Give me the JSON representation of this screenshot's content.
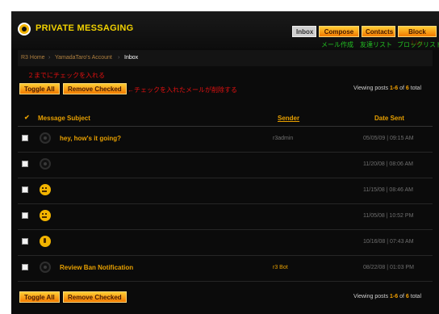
{
  "header": {
    "title": "PRIVATE MESSAGING",
    "tabs": [
      {
        "label": "Inbox",
        "note": ""
      },
      {
        "label": "Compose",
        "note": "メール作成"
      },
      {
        "label": "Contacts",
        "note": "友達リスト"
      },
      {
        "label": "Block List",
        "note": "ブロックリスト"
      }
    ]
  },
  "breadcrumb": {
    "items": [
      "R3 Home",
      "YamadaTaro's Account",
      "Inbox"
    ]
  },
  "annotations": {
    "check_note": "２までにチェックを入れる",
    "delete_note": "←チェックを入れたメールが削除する"
  },
  "actions": {
    "toggle_all": "Toggle All",
    "remove_checked": "Remove Checked",
    "viewing_prefix": "Viewing posts",
    "viewing_range": "1-6",
    "viewing_of": "of",
    "viewing_total": "6",
    "viewing_suffix": "total"
  },
  "table": {
    "headers": {
      "check": "✔",
      "subject": "Message Subject",
      "sender": "Sender",
      "date": "Date Sent"
    },
    "rows": [
      {
        "icon": "dark",
        "subject": "hey, how's it going?",
        "sender": "r3admin",
        "date": "05/05/09 | 09:15 AM"
      },
      {
        "icon": "dark",
        "subject": "",
        "sender": "",
        "date": "11/20/08 | 08:06 AM"
      },
      {
        "icon": "smile",
        "subject": "",
        "sender": "",
        "date": "11/15/08 | 08:46 AM"
      },
      {
        "icon": "smile",
        "subject": "",
        "sender": "",
        "date": "11/05/08 | 10:52 PM"
      },
      {
        "icon": "neutral",
        "subject": "",
        "sender": "",
        "date": "10/16/08 | 07:43 AM"
      },
      {
        "icon": "dark",
        "subject": "Review Ban Notification",
        "sender": "r3 Bot",
        "date": "08/22/08 | 01:03 PM"
      }
    ]
  },
  "colors": {
    "accent": "#e8a000",
    "button_top": "#ffcc33",
    "button_bottom": "#f27a00",
    "note_red": "#e01010",
    "note_green": "#22c022"
  }
}
